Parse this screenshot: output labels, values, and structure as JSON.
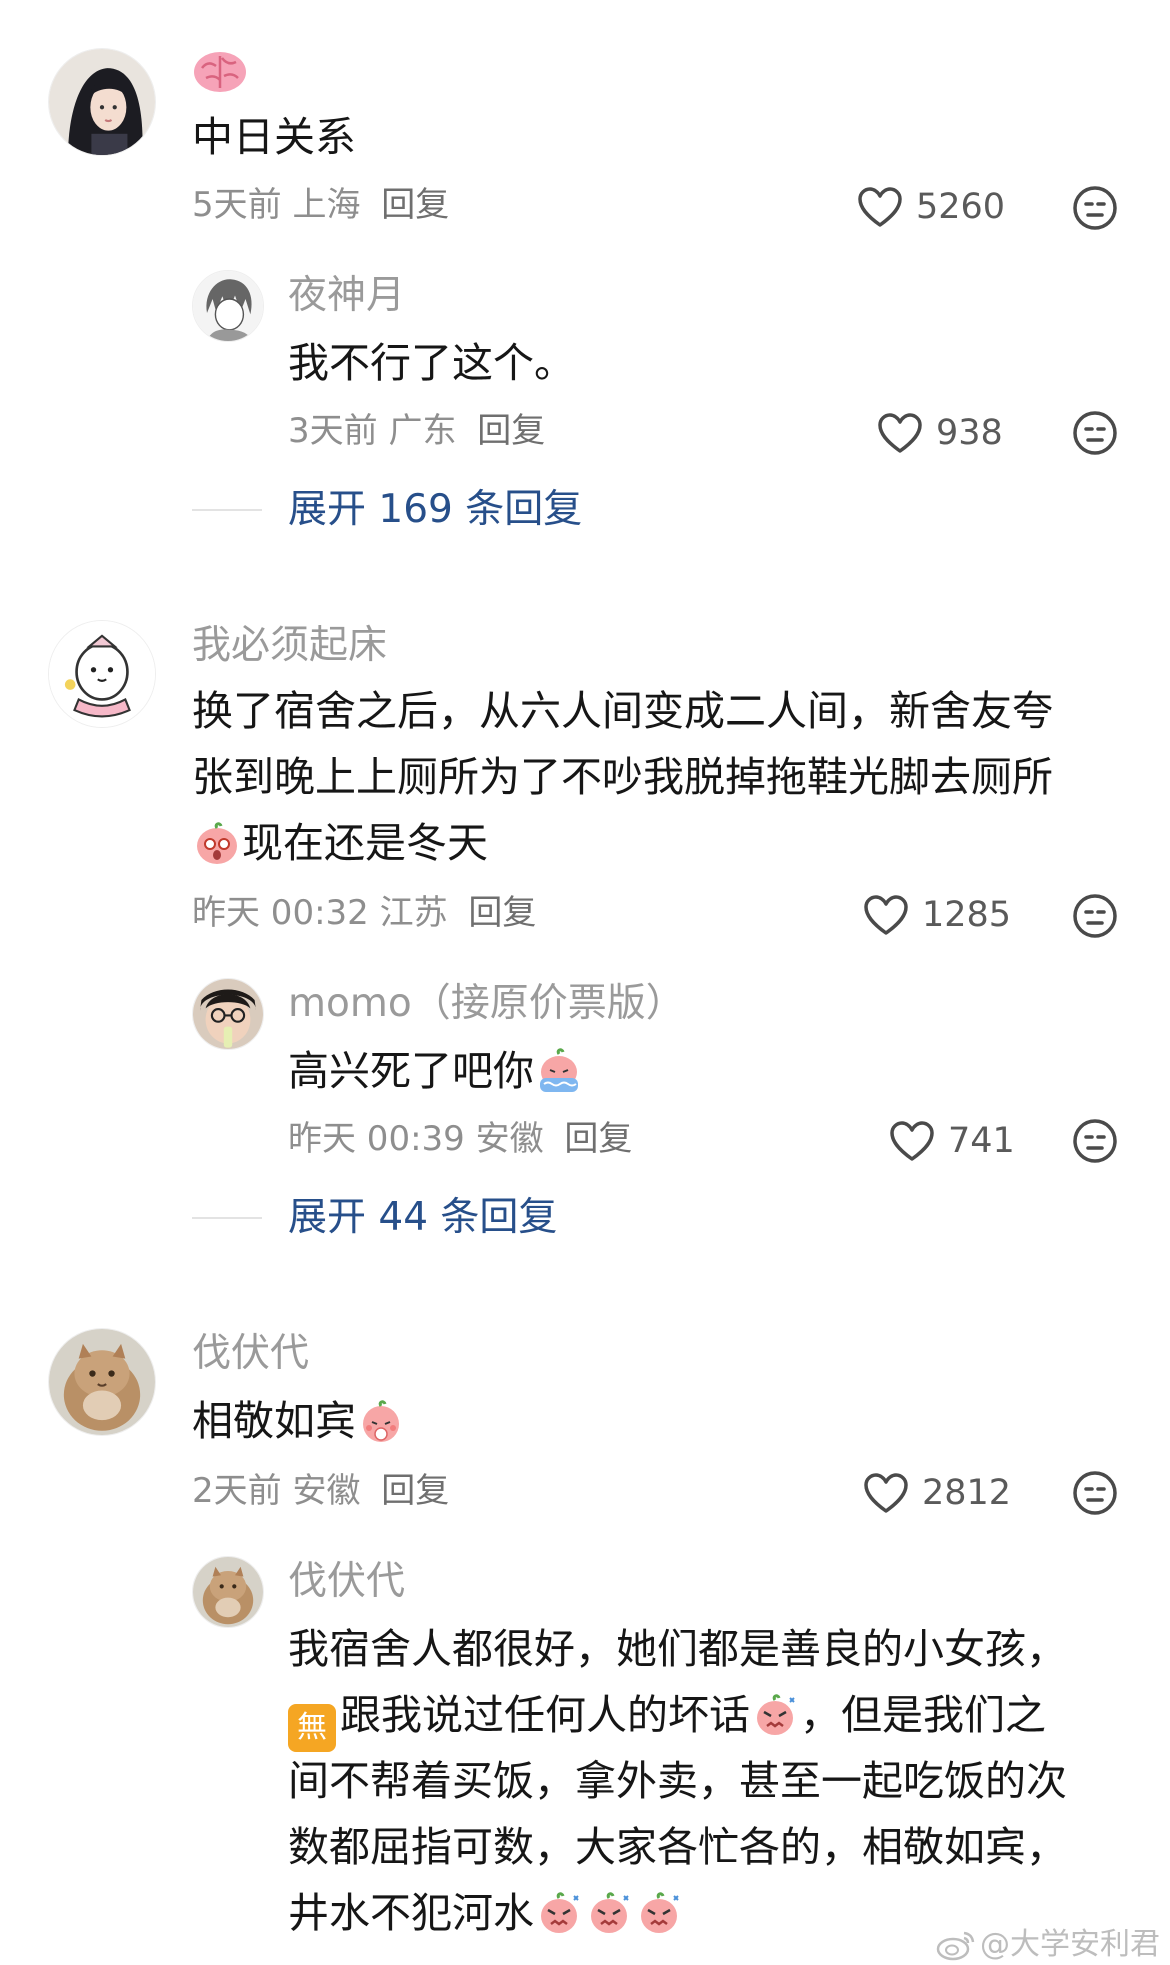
{
  "comments": [
    {
      "emoji_name": "brain-emoji",
      "text": "中日关系",
      "time": "5天前",
      "location": "上海",
      "reply_label": "回复",
      "likes": "5260",
      "replies": [
        {
          "username": "夜神月",
          "text": "我不行了这个。",
          "time": "3天前",
          "location": "广东",
          "reply_label": "回复",
          "likes": "938"
        }
      ],
      "expand_label": "展开 169 条回复"
    },
    {
      "username": "我必须起床",
      "text_line1": "换了宿舍之后，从六人间变成二人间，新舍友夸",
      "text_line2": "张到晚上上厕所为了不吵我脱掉拖鞋光脚去厕所",
      "text_line3": "现在还是冬天",
      "time": "昨天 00:32",
      "location": "江苏",
      "reply_label": "回复",
      "likes": "1285",
      "replies": [
        {
          "username": "momo（接原价票版）",
          "text": "高兴死了吧你",
          "time": "昨天 00:39",
          "location": "安徽",
          "reply_label": "回复",
          "likes": "741"
        }
      ],
      "expand_label": "展开 44 条回复"
    },
    {
      "username": "伐伏代",
      "text": "相敬如宾",
      "time": "2天前",
      "location": "安徽",
      "reply_label": "回复",
      "likes": "2812",
      "replies": [
        {
          "username": "伐伏代",
          "text_line1": "我宿舍人都很好，她们都是善良的小女孩，",
          "text_line2a": "跟我说过任何人的坏话",
          "text_line2b": "，但是我们之",
          "text_line3": "间不帮着买饭，拿外卖，甚至一起吃饭的次",
          "text_line4": "数都屈指可数，大家各忙各的，相敬如宾，",
          "text_line5": "井水不犯河水",
          "badge_text": "無"
        }
      ]
    }
  ],
  "watermark": "@大学安利君",
  "colors": {
    "link": "#274f8a",
    "meta": "#8e8e8e",
    "name": "#9a9a9a",
    "text": "#161616",
    "badge": "#f5a623"
  },
  "icons": [
    "heart-outline-icon",
    "dislike-face-icon",
    "peach-emoji",
    "weibo-logo-icon"
  ]
}
